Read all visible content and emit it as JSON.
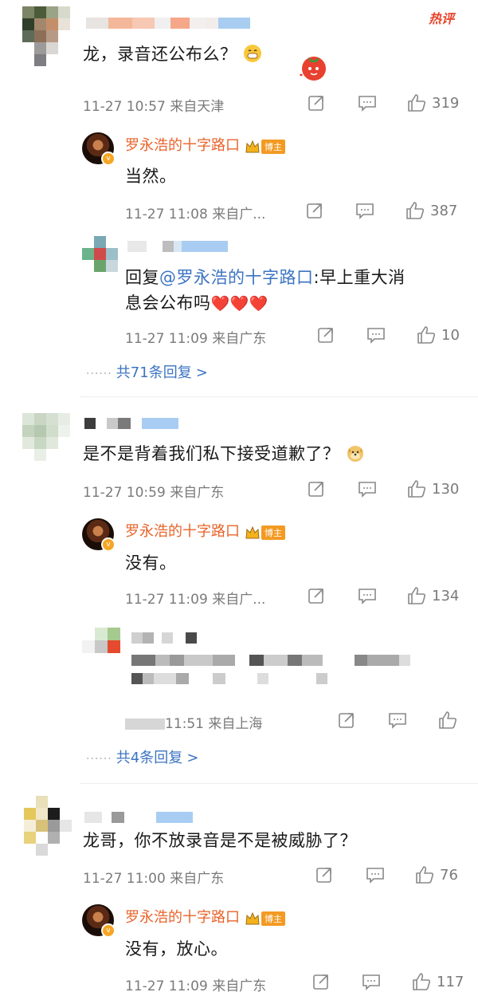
{
  "header": {
    "hot_label": "热评"
  },
  "colors": {
    "accent": "#e8632a",
    "link": "#3c74c2",
    "heart": "#e8333a",
    "badge": "#f39a22"
  },
  "comments": [
    {
      "text": "龙，录音还公布么？",
      "time": "11-27 10:57",
      "location": "来自天津",
      "likes": "319",
      "reply": {
        "author": "罗永浩的十字路口",
        "badge": "博主",
        "text": "当然。",
        "time": "11-27 11:08",
        "location": "来自广...",
        "likes": "387"
      },
      "sub_reply": {
        "prefix": "回复",
        "mention": "@罗永浩的十字路口",
        "text_line1": ":早上重大消",
        "text_line2": "息会公布吗",
        "hearts": "❤️❤️❤️",
        "time": "11-27 11:09",
        "location": "来自广东",
        "likes": "10"
      },
      "more": "共71条回复",
      "more_chevron": ">"
    },
    {
      "text": "是不是背着我们私下接受道歉了？",
      "time": "11-27 10:59",
      "location": "来自广东",
      "likes": "130",
      "reply": {
        "author": "罗永浩的十字路口",
        "badge": "博主",
        "text": "没有。",
        "time": "11-27 11:09",
        "location": "来自广...",
        "likes": "134"
      },
      "sub_reply": {
        "time_suffix": "11:51",
        "location": "来自上海"
      },
      "more": "共4条回复",
      "more_chevron": ">"
    },
    {
      "text": "龙哥，你不放录音是不是被威胁了？",
      "time": "11-27 11:00",
      "location": "来自广东",
      "likes": "76",
      "reply": {
        "author": "罗永浩的十字路口",
        "badge": "博主",
        "text": "没有，放心。",
        "time": "11-27 11:09",
        "location": "来自广东",
        "likes": "117"
      }
    }
  ]
}
